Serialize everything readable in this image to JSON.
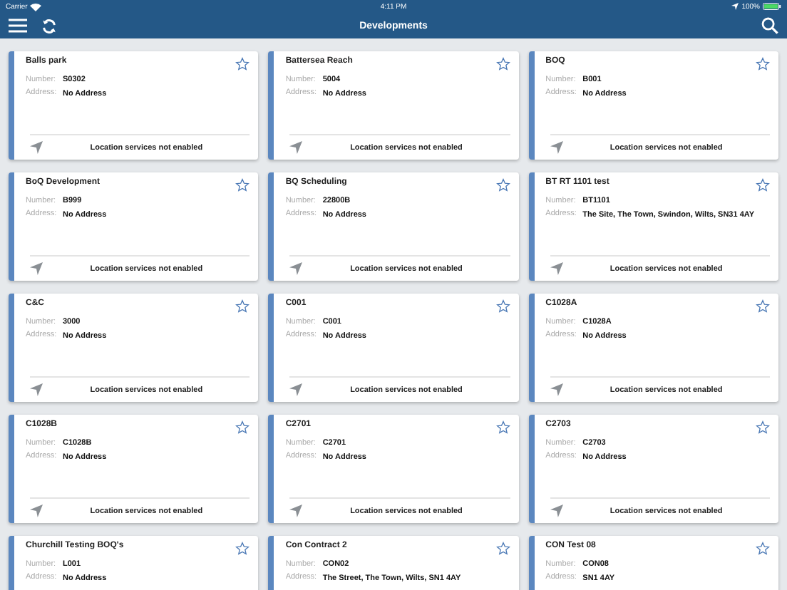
{
  "status_bar": {
    "carrier": "Carrier",
    "time": "4:11 PM",
    "battery": "100%"
  },
  "nav": {
    "title": "Developments"
  },
  "cards": [
    {
      "name": "Balls park",
      "number_label": "Number:",
      "number": "S0302",
      "address_label": "Address:",
      "address": "No Address",
      "location": "Location services not enabled",
      "favorite": false
    },
    {
      "name": "Battersea Reach",
      "number_label": "Number:",
      "number": "5004",
      "address_label": "Address:",
      "address": "No Address",
      "location": "Location services not enabled",
      "favorite": false
    },
    {
      "name": "BOQ",
      "number_label": "Number:",
      "number": "B001",
      "address_label": "Address:",
      "address": "No Address",
      "location": "Location services not enabled",
      "favorite": false
    },
    {
      "name": "BoQ Development",
      "number_label": "Number:",
      "number": "B999",
      "address_label": "Address:",
      "address": "No Address",
      "location": "Location services not enabled",
      "favorite": false
    },
    {
      "name": "BQ Scheduling",
      "number_label": "Number:",
      "number": "22800B",
      "address_label": "Address:",
      "address": "No Address",
      "location": "Location services not enabled",
      "favorite": false
    },
    {
      "name": "BT RT 1101 test",
      "number_label": "Number:",
      "number": "BT1101",
      "address_label": "Address:",
      "address": "The Site, The Town, Swindon, Wilts, SN31 4AY",
      "location": "Location services not enabled",
      "favorite": false
    },
    {
      "name": "C&C",
      "number_label": "Number:",
      "number": "3000",
      "address_label": "Address:",
      "address": "No Address",
      "location": "Location services not enabled",
      "favorite": false
    },
    {
      "name": "C001",
      "number_label": "Number:",
      "number": "C001",
      "address_label": "Address:",
      "address": "No Address",
      "location": "Location services not enabled",
      "favorite": false
    },
    {
      "name": "C1028A",
      "number_label": "Number:",
      "number": "C1028A",
      "address_label": "Address:",
      "address": "No Address",
      "location": "Location services not enabled",
      "favorite": false
    },
    {
      "name": "C1028B",
      "number_label": "Number:",
      "number": "C1028B",
      "address_label": "Address:",
      "address": "No Address",
      "location": "Location services not enabled",
      "favorite": false
    },
    {
      "name": "C2701",
      "number_label": "Number:",
      "number": "C2701",
      "address_label": "Address:",
      "address": "No Address",
      "location": "Location services not enabled",
      "favorite": false
    },
    {
      "name": "C2703",
      "number_label": "Number:",
      "number": "C2703",
      "address_label": "Address:",
      "address": "No Address",
      "location": "Location services not enabled",
      "favorite": false
    },
    {
      "name": "Churchill Testing BOQ's",
      "number_label": "Number:",
      "number": "L001",
      "address_label": "Address:",
      "address": "No Address",
      "favorite": false
    },
    {
      "name": "Con Contract 2",
      "number_label": "Number:",
      "number": "CON02",
      "address_label": "Address:",
      "address": "The Street, The Town, Wilts, SN1 4AY",
      "favorite": false
    },
    {
      "name": "CON Test 08",
      "number_label": "Number:",
      "number": "CON08",
      "address_label": "Address:",
      "address": "SN1 4AY",
      "favorite": false
    }
  ]
}
